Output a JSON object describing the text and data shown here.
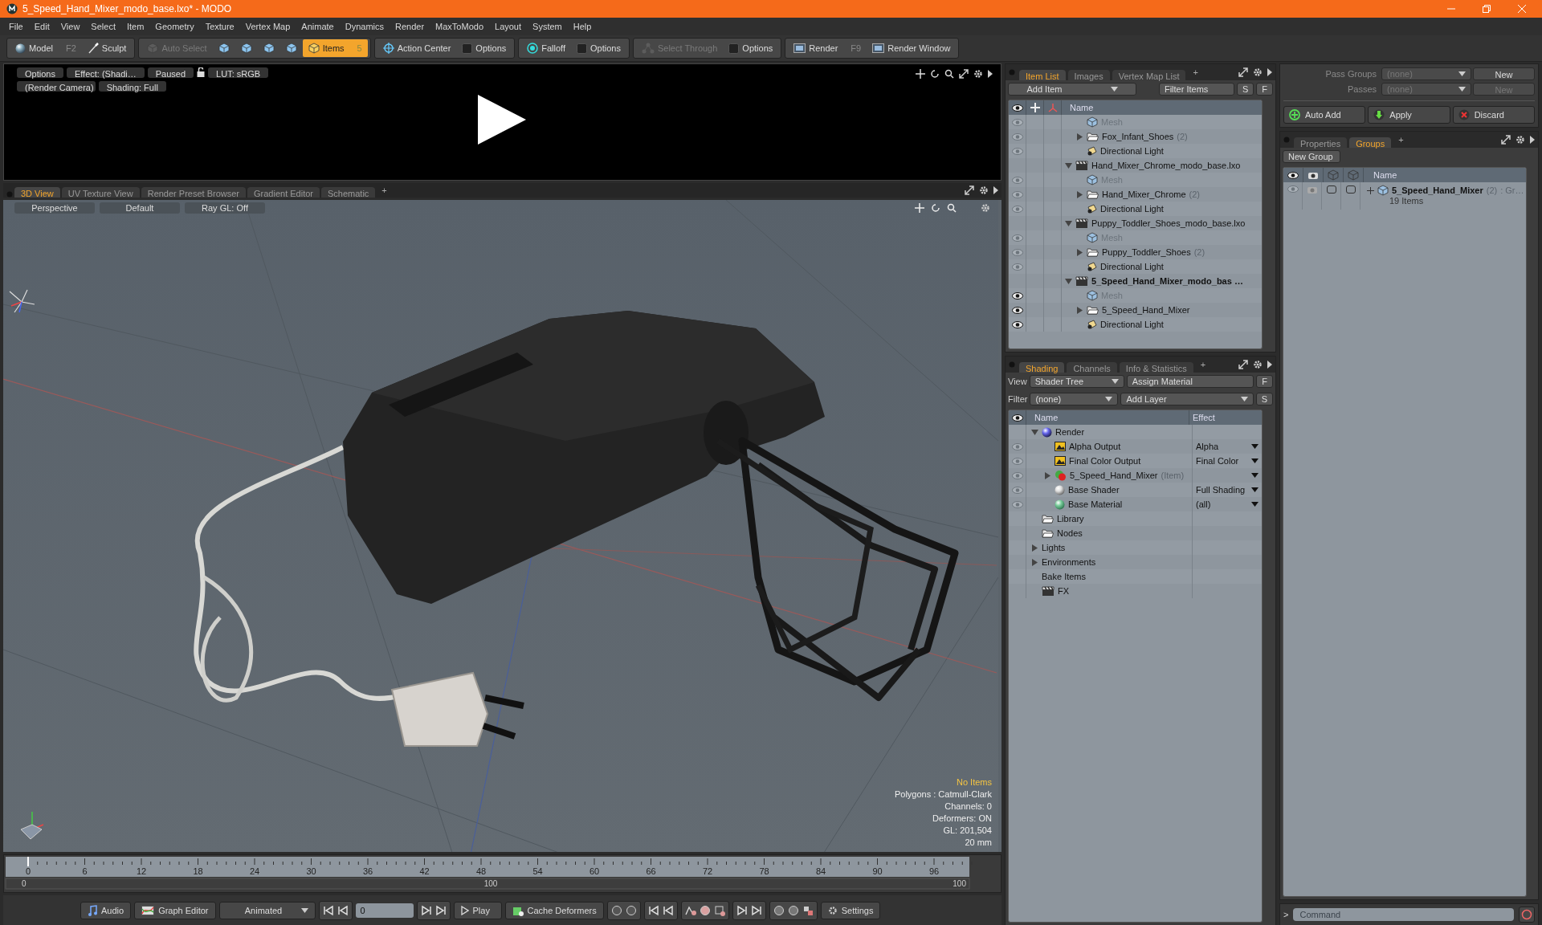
{
  "window": {
    "title": "5_Speed_Hand_Mixer_modo_base.lxo* - MODO"
  },
  "menu": [
    "File",
    "Edit",
    "View",
    "Select",
    "Item",
    "Geometry",
    "Texture",
    "Vertex Map",
    "Animate",
    "Dynamics",
    "Render",
    "MaxToModo",
    "Layout",
    "System",
    "Help"
  ],
  "toolbar": [
    {
      "items": [
        {
          "kind": "model",
          "label": "Model",
          "shortcut": "F2",
          "selected": false,
          "disabled": false
        },
        {
          "kind": "sculpt",
          "label": "Sculpt",
          "selected": false,
          "disabled": false
        }
      ]
    },
    {
      "items": [
        {
          "kind": "auto_select",
          "label": "Auto Select",
          "selected": false,
          "disabled": true
        },
        {
          "kind": "select_mode",
          "selected": false,
          "disabled": false
        },
        {
          "kind": "select_mode",
          "selected": false,
          "disabled": false
        },
        {
          "kind": "select_mode",
          "selected": false,
          "disabled": false
        },
        {
          "kind": "select_mode",
          "selected": false,
          "disabled": false
        },
        {
          "kind": "items",
          "label": "Items",
          "shortcut": "5",
          "selected": true,
          "disabled": false
        }
      ]
    },
    {
      "items": [
        {
          "kind": "action_center",
          "label": "Action Center",
          "selected": false,
          "disabled": false
        },
        {
          "kind": "options",
          "label": "Options",
          "selected": false,
          "disabled": false
        }
      ]
    },
    {
      "items": [
        {
          "kind": "falloff",
          "label": "Falloff",
          "selected": false,
          "disabled": false
        },
        {
          "kind": "options",
          "label": "Options",
          "selected": false,
          "disabled": false
        }
      ]
    },
    {
      "items": [
        {
          "kind": "select_through",
          "label": "Select Through",
          "selected": false,
          "disabled": true
        },
        {
          "kind": "options",
          "label": "Options",
          "selected": false,
          "disabled": false
        }
      ]
    },
    {
      "items": [
        {
          "kind": "render",
          "label": "Render",
          "shortcut": "F9",
          "selected": false,
          "disabled": false
        },
        {
          "kind": "render_window",
          "label": "Render Window",
          "selected": false,
          "disabled": false
        }
      ]
    }
  ],
  "preview": {
    "row1": [
      {
        "kind": "button",
        "label": "Options"
      },
      {
        "kind": "button",
        "label": "Effect: (Shadi…"
      },
      {
        "kind": "button",
        "label": "Paused"
      },
      {
        "kind": "lock"
      },
      {
        "kind": "button",
        "label": "LUT: sRGB"
      }
    ],
    "row2": [
      "(Render Camera)",
      "Shading: Full"
    ]
  },
  "viewport": {
    "tabs": [
      {
        "label": "3D View",
        "selected": true
      },
      {
        "label": "UV Texture View",
        "selected": false
      },
      {
        "label": "Render Preset Browser",
        "selected": false
      },
      {
        "label": "Gradient Editor",
        "selected": false
      },
      {
        "label": "Schematic",
        "selected": false
      }
    ],
    "add_tab": "+",
    "header": [
      "Perspective",
      "Default",
      "Ray GL: Off"
    ],
    "info": [
      {
        "text": "No Items",
        "highlight": true
      },
      {
        "text": "Polygons : Catmull-Clark",
        "highlight": false
      },
      {
        "text": "Channels: 0",
        "highlight": false
      },
      {
        "text": "Deformers: ON",
        "highlight": false
      },
      {
        "text": "GL: 201,504",
        "highlight": false
      },
      {
        "text": "20 mm",
        "highlight": false
      }
    ]
  },
  "timeline": {
    "labels": [
      "0",
      "6",
      "12",
      "18",
      "24",
      "30",
      "36",
      "42",
      "48",
      "54",
      "60",
      "66",
      "72",
      "78",
      "84",
      "90",
      "96"
    ],
    "range": [
      "0",
      "100",
      "100"
    ]
  },
  "transport": {
    "audio": "Audio",
    "graph_editor": "Graph Editor",
    "mode": "Animated",
    "frame": "0",
    "play": "Play",
    "cache": "Cache Deformers",
    "settings": "Settings"
  },
  "item_list": {
    "tabs": [
      {
        "label": "Item List",
        "selected": true
      },
      {
        "label": "Images",
        "selected": false
      },
      {
        "label": "Vertex Map List",
        "selected": false
      }
    ],
    "add_tab": "+",
    "add_item": "Add Item",
    "filter": "Filter Items",
    "buttons": [
      "S",
      "F"
    ],
    "column": "Name",
    "tree": [
      {
        "children": [
          {
            "kind": "mesh",
            "label": "Mesh",
            "eye": true,
            "disabled": true
          },
          {
            "kind": "group",
            "label": "Fox_Infant_Shoes",
            "count": "(2)",
            "eye": true,
            "disabled": false,
            "expanded": false
          },
          {
            "kind": "light",
            "label": "Directional Light",
            "eye": true,
            "disabled": false
          }
        ]
      },
      {
        "kind": "scene",
        "label": "Hand_Mixer_Chrome_modo_base.lxo",
        "current": false,
        "expanded": true,
        "children": [
          {
            "kind": "mesh",
            "label": "Mesh",
            "eye": true,
            "disabled": true
          },
          {
            "kind": "group",
            "label": "Hand_Mixer_Chrome",
            "count": "(2)",
            "eye": true,
            "disabled": false,
            "expanded": false
          },
          {
            "kind": "light",
            "label": "Directional Light",
            "eye": true,
            "disabled": false
          }
        ]
      },
      {
        "kind": "scene",
        "label": "Puppy_Toddler_Shoes_modo_base.lxo",
        "current": false,
        "expanded": true,
        "children": [
          {
            "kind": "mesh",
            "label": "Mesh",
            "eye": true,
            "disabled": true
          },
          {
            "kind": "group",
            "label": "Puppy_Toddler_Shoes",
            "count": "(2)",
            "eye": true,
            "disabled": false,
            "expanded": false
          },
          {
            "kind": "light",
            "label": "Directional Light",
            "eye": true,
            "disabled": false
          }
        ]
      },
      {
        "kind": "scene",
        "label": "5_Speed_Hand_Mixer_modo_bas …",
        "current": true,
        "expanded": true,
        "children": [
          {
            "kind": "mesh",
            "label": "Mesh",
            "eye": true,
            "disabled": true
          },
          {
            "kind": "group",
            "label": "5_Speed_Hand_Mixer",
            "eye": true,
            "disabled": false,
            "expanded": false
          },
          {
            "kind": "light",
            "label": "Directional Light",
            "eye": true,
            "disabled": false
          }
        ]
      }
    ]
  },
  "shading": {
    "tabs": [
      {
        "label": "Shading",
        "selected": true
      },
      {
        "label": "Channels",
        "selected": false
      },
      {
        "label": "Info & Statistics",
        "selected": false
      }
    ],
    "add_tab": "+",
    "view_label": "View",
    "view": "Shader Tree",
    "assign": "Assign Material",
    "f": "F",
    "filter_label": "Filter",
    "filter": "(none)",
    "add_layer": "Add Layer",
    "s": "S",
    "columns": [
      "Name",
      "Effect"
    ],
    "tree": [
      {
        "kind": "render",
        "label": "Render",
        "expanded": true,
        "children": [
          {
            "kind": "output",
            "label": "Alpha Output",
            "effect": "Alpha"
          },
          {
            "kind": "output",
            "label": "Final Color Output",
            "effect": "Final Color"
          },
          {
            "kind": "material_group",
            "label": "5_Speed_Hand_Mixer",
            "note": "(Item)",
            "expanded": false
          },
          {
            "kind": "shader",
            "label": "Base Shader",
            "effect": "Full Shading"
          },
          {
            "kind": "material",
            "label": "Base Material",
            "effect": "(all)"
          }
        ]
      },
      {
        "kind": "folder",
        "label": "Library"
      },
      {
        "kind": "folder",
        "label": "Nodes"
      },
      {
        "kind": "plain",
        "label": "Lights",
        "expanded": false
      },
      {
        "kind": "plain",
        "label": "Environments",
        "expanded": false
      },
      {
        "kind": "plain",
        "label": "Bake Items"
      },
      {
        "kind": "fx",
        "label": "FX"
      }
    ]
  },
  "passes": {
    "rows": [
      {
        "label": "Pass Groups",
        "value": "(none)",
        "button": "New",
        "disabled": false
      },
      {
        "label": "Passes",
        "value": "(none)",
        "button": "New",
        "disabled": true
      }
    ],
    "actions": [
      {
        "kind": "add",
        "label": "Auto Add"
      },
      {
        "kind": "apply",
        "label": "Apply"
      },
      {
        "kind": "discard",
        "label": "Discard"
      }
    ]
  },
  "groups": {
    "tabs": [
      {
        "label": "Properties",
        "selected": false
      },
      {
        "label": "Groups",
        "selected": true
      }
    ],
    "add_tab": "+",
    "new_group": "New Group",
    "column": "Name",
    "rows": [
      {
        "label": "5_Speed_Hand_Mixer",
        "count": "(2)",
        "suffix": ": Gr…",
        "detail": "19 Items",
        "expanded": false
      }
    ]
  },
  "command": {
    "prompt": ">",
    "placeholder": "Command"
  }
}
